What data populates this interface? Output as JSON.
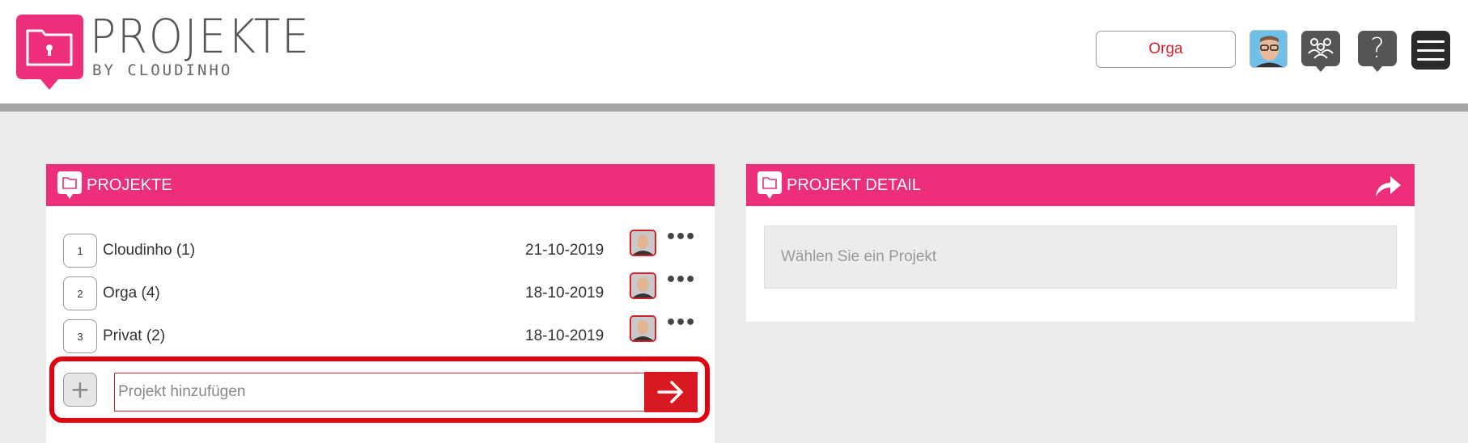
{
  "header": {
    "brand_title": "PROJEKTE",
    "brand_subtitle": "BY CLOUDINHO",
    "org_button_label": "Orga",
    "help_glyph": "?"
  },
  "projects_panel": {
    "title": "PROJEKTE",
    "rows": [
      {
        "number": "1",
        "name": "Cloudinho (1)",
        "date": "21-10-2019",
        "more": "•••"
      },
      {
        "number": "2",
        "name": "Orga (4)",
        "date": "18-10-2019",
        "more": "•••"
      },
      {
        "number": "3",
        "name": "Privat (2)",
        "date": "18-10-2019",
        "more": "•••"
      }
    ],
    "add": {
      "plus_glyph": "+",
      "placeholder": "Projekt hinzufügen"
    }
  },
  "detail_panel": {
    "title": "PROJEKT DETAIL",
    "placeholder": "Wählen Sie ein Projekt"
  },
  "colors": {
    "brand_pink": "#ec2e7b",
    "accent_red": "#d81921",
    "highlight_red": "#e3000f"
  },
  "icons": [
    "folder-lock-logo-icon",
    "avatar",
    "team-icon",
    "help-icon",
    "menu-icon",
    "folder-icon",
    "share-icon",
    "more-icon",
    "plus-icon",
    "arrow-right-icon"
  ]
}
